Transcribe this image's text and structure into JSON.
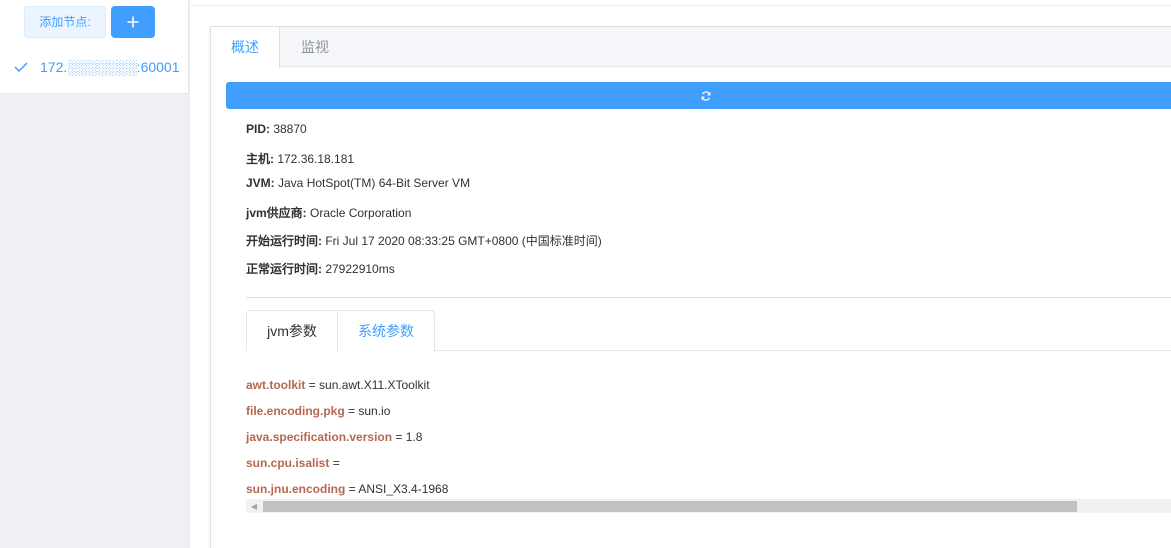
{
  "sidebar": {
    "add_node_label": "添加节点:",
    "add_button_icon": "plus-icon",
    "nodes": [
      {
        "label": "172.░░░░░░░:60001",
        "selected": true,
        "icon": "check-icon"
      }
    ]
  },
  "tabs": [
    {
      "label": "概述",
      "active": true
    },
    {
      "label": "监视",
      "active": false
    }
  ],
  "refresh_icon": "refresh-icon",
  "info": [
    {
      "label": "PID:",
      "value": " 38870"
    },
    {
      "label": "主机:",
      "value": " 172.36.18.181"
    },
    {
      "label": "JVM:",
      "value": " Java HotSpot(TM) 64-Bit Server VM"
    },
    {
      "label": "jvm供应商:",
      "value": " Oracle Corporation"
    },
    {
      "label": "开始运行时间:",
      "value": " Fri Jul 17 2020 08:33:25 GMT+0800 (中国标准时间)"
    },
    {
      "label": "正常运行时间:",
      "value": " 27922910ms"
    }
  ],
  "subtabs": [
    {
      "label": "jvm参数",
      "active": false
    },
    {
      "label": "系统参数",
      "active": true
    }
  ],
  "system_properties": [
    {
      "key": "awt.toolkit",
      "value": " = sun.awt.X11.XToolkit"
    },
    {
      "key": "file.encoding.pkg",
      "value": " = sun.io"
    },
    {
      "key": "java.specification.version",
      "value": " = 1.8"
    },
    {
      "key": "sun.cpu.isalist",
      "value": " ="
    },
    {
      "key": "sun.jnu.encoding",
      "value": " = ANSI_X3.4-1968"
    }
  ],
  "colors": {
    "accent": "#409eff",
    "property_key": "#b5684f",
    "sidebar_bg": "#eef0f4"
  }
}
